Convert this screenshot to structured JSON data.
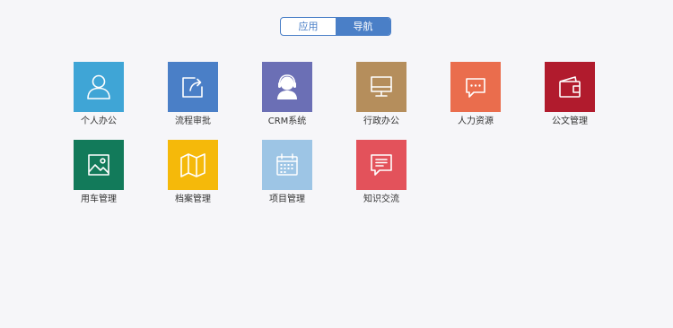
{
  "tabs": [
    {
      "label": "应用",
      "active": false
    },
    {
      "label": "导航",
      "active": true
    }
  ],
  "tiles": [
    {
      "label": "个人办公",
      "icon": "user-icon",
      "color": "#3fa5d6"
    },
    {
      "label": "流程审批",
      "icon": "share-icon",
      "color": "#4a7fc7"
    },
    {
      "label": "CRM系统",
      "icon": "customer-service-icon",
      "color": "#6b6fb5"
    },
    {
      "label": "行政办公",
      "icon": "monitor-icon",
      "color": "#b58e5c"
    },
    {
      "label": "人力资源",
      "icon": "chat-bubble-icon",
      "color": "#ea6d4d"
    },
    {
      "label": "公文管理",
      "icon": "wallet-icon",
      "color": "#b11b2d"
    },
    {
      "label": "用车管理",
      "icon": "image-icon",
      "color": "#127a5a"
    },
    {
      "label": "档案管理",
      "icon": "map-icon",
      "color": "#f5b90a"
    },
    {
      "label": "项目管理",
      "icon": "calendar-icon",
      "color": "#9dc5e5"
    },
    {
      "label": "知识交流",
      "icon": "message-icon",
      "color": "#e3525b"
    }
  ]
}
